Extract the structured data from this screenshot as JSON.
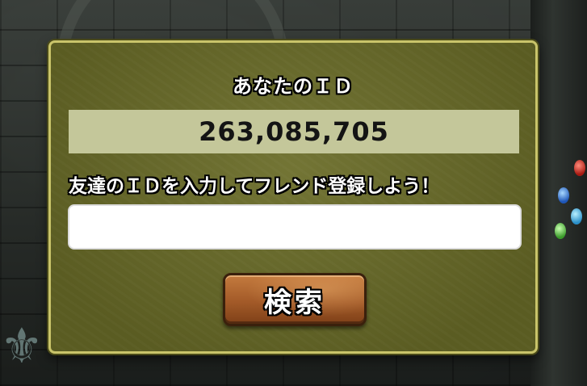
{
  "dialog": {
    "your_id_label": "あなたのＩＤ",
    "your_id_value": "263,085,705",
    "friend_prompt": "友達のＩＤを入力してフレンド登録しよう！",
    "friend_id_input_value": "",
    "search_button_label": "検索"
  },
  "colors": {
    "dialog_background": "#6a6c28",
    "dialog_border": "#c9c46a",
    "id_box_background": "#c4c79a",
    "button_brown": "#a35a28"
  },
  "icons": {
    "background_ornament": "fleur-de-lis-icon",
    "gems": [
      "red-gem-icon",
      "blue-gem-icon",
      "cyan-gem-icon",
      "green-gem-icon"
    ]
  }
}
